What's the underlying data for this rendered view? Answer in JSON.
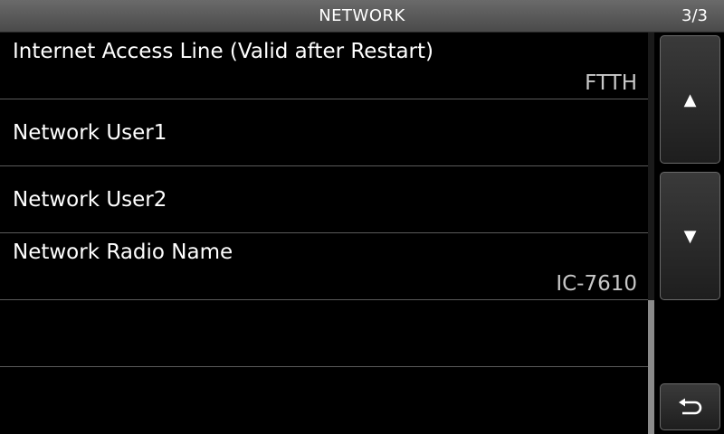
{
  "header": {
    "title": "NETWORK",
    "page_indicator": "3/3"
  },
  "menu": {
    "items": [
      {
        "label": "Internet Access Line (Valid after Restart)",
        "value": "FTTH"
      },
      {
        "label": "Network User1",
        "value": ""
      },
      {
        "label": "Network User2",
        "value": ""
      },
      {
        "label": "Network Radio Name",
        "value": "IC-7610"
      },
      {
        "label": "",
        "value": ""
      },
      {
        "label": "",
        "value": ""
      }
    ]
  },
  "controls": {
    "up_glyph": "▲",
    "down_glyph": "▼",
    "back_icon": "return-arrow-icon"
  },
  "colors": {
    "background": "#000000",
    "titlebar": "#5a5a5a",
    "divider": "#5a5a5a",
    "value_text": "#c8c8c8"
  }
}
